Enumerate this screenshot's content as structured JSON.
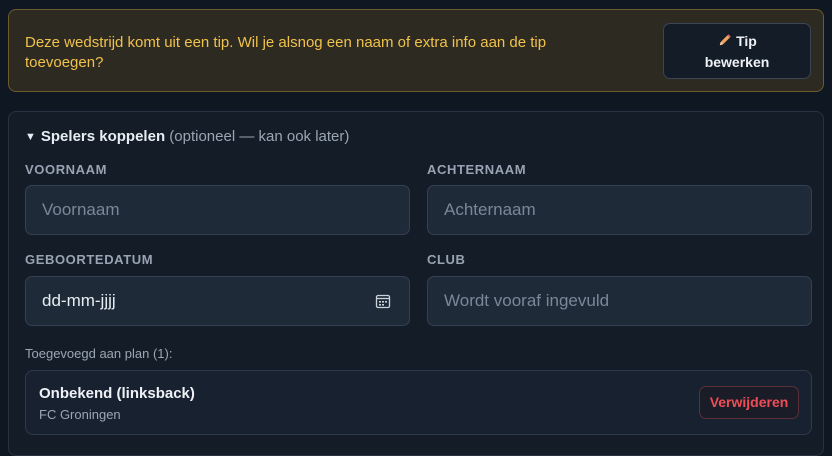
{
  "notice": {
    "text": "Deze wedstrijd komt uit een tip. Wil je alsnog een naam of extra info aan de tip toevoegen?",
    "button_label_line1": "Tip",
    "button_label_line2": "bewerken",
    "icon": "pencil-icon",
    "accent": "#f0c24b"
  },
  "players": {
    "summary_title": "Spelers koppelen",
    "summary_note": "(optioneel — kan ook later)",
    "fields": {
      "first_name_label": "VOORNAAM",
      "first_name_placeholder": "Voornaam",
      "last_name_label": "ACHTERNAAM",
      "last_name_placeholder": "Achternaam",
      "birthdate_label": "GEBOORTEDATUM",
      "birthdate_value": "dd-mm-jjjj",
      "club_label": "CLUB",
      "club_placeholder": "Wordt vooraf ingevuld"
    },
    "added_label": "Toegevoegd aan plan (1):",
    "added": [
      {
        "name": "Onbekend (linksback)",
        "club": "FC Groningen",
        "remove_label": "Verwijderen"
      }
    ]
  }
}
